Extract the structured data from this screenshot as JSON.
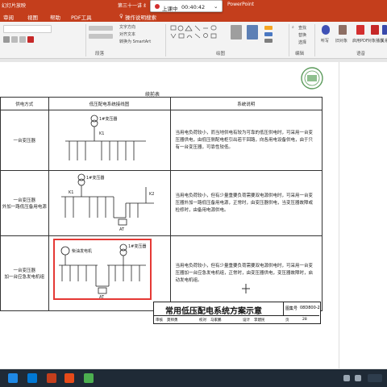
{
  "window": {
    "left_label": "幻灯片放映",
    "doc_title": "第三十一讲 纟",
    "app_name": "PowerPoint"
  },
  "recorder": {
    "status": "上课中",
    "time": "00:40:42"
  },
  "tabs": [
    "审阅",
    "视图",
    "帮助",
    "PDF工具",
    "操作说明搜索"
  ],
  "ribbon": {
    "paragraph_items": [
      "文字方向",
      "对齐文本",
      "转换为 SmartArt"
    ],
    "groups": [
      "段落",
      "绘图",
      "编辑",
      "语音"
    ],
    "edit_items": [
      "查找",
      "替换",
      "选择"
    ],
    "right_buttons": [
      "听写",
      "旧对象",
      "启用PDF",
      "对象播放",
      "关系"
    ]
  },
  "sheet": {
    "continued": "续前表",
    "headers": [
      "供电方式",
      "低压配电系统接线图",
      "系统说明"
    ],
    "rows": [
      {
        "mode": "一台变压器",
        "desc": "当用电负荷较小，而当地供电有较为可靠的低压供电时，可采用一台变压器供电，由低压侧配电柜引出若干回路，向各用电设备供电，由于只有一台变压器，可靠性较低。",
        "labels": [
          "1#变压器",
          "K1"
        ]
      },
      {
        "mode": "一台变压器\n外加一路低压备用电源",
        "desc": "当用电负荷较小，但有少量重要负荷需要双电源供电时，可采用一台变压器外加一路低压备用电源，正常时，由变压器供电，当变压器故障或检修时，由备用电源供电。",
        "labels": [
          "1#变压器",
          "K1",
          "K2",
          "AT"
        ]
      },
      {
        "mode": "一台变压器\n加一台应急发电机组",
        "desc": "当用电负荷较小，但有少量重要负荷需要双电源供电时，可采用一台变压器加一台应急发电机组，正常时，由变压器供电，变压器故障时，启动发电机组。",
        "labels": [
          "柴油发电机",
          "1#变压器",
          "AT"
        ]
      }
    ]
  },
  "title_block": {
    "title": "常用低压配电系统方案示意",
    "fig_no_label": "图集号",
    "fig_no": "08D800-2",
    "page_label": "页",
    "page": "28",
    "sign_cells": [
      "审核",
      "莫师勇",
      "校对",
      "马家鹏",
      "设计",
      "李建民"
    ]
  },
  "colors": {
    "accent": "#c43e1c",
    "highlight": "#e53935"
  }
}
